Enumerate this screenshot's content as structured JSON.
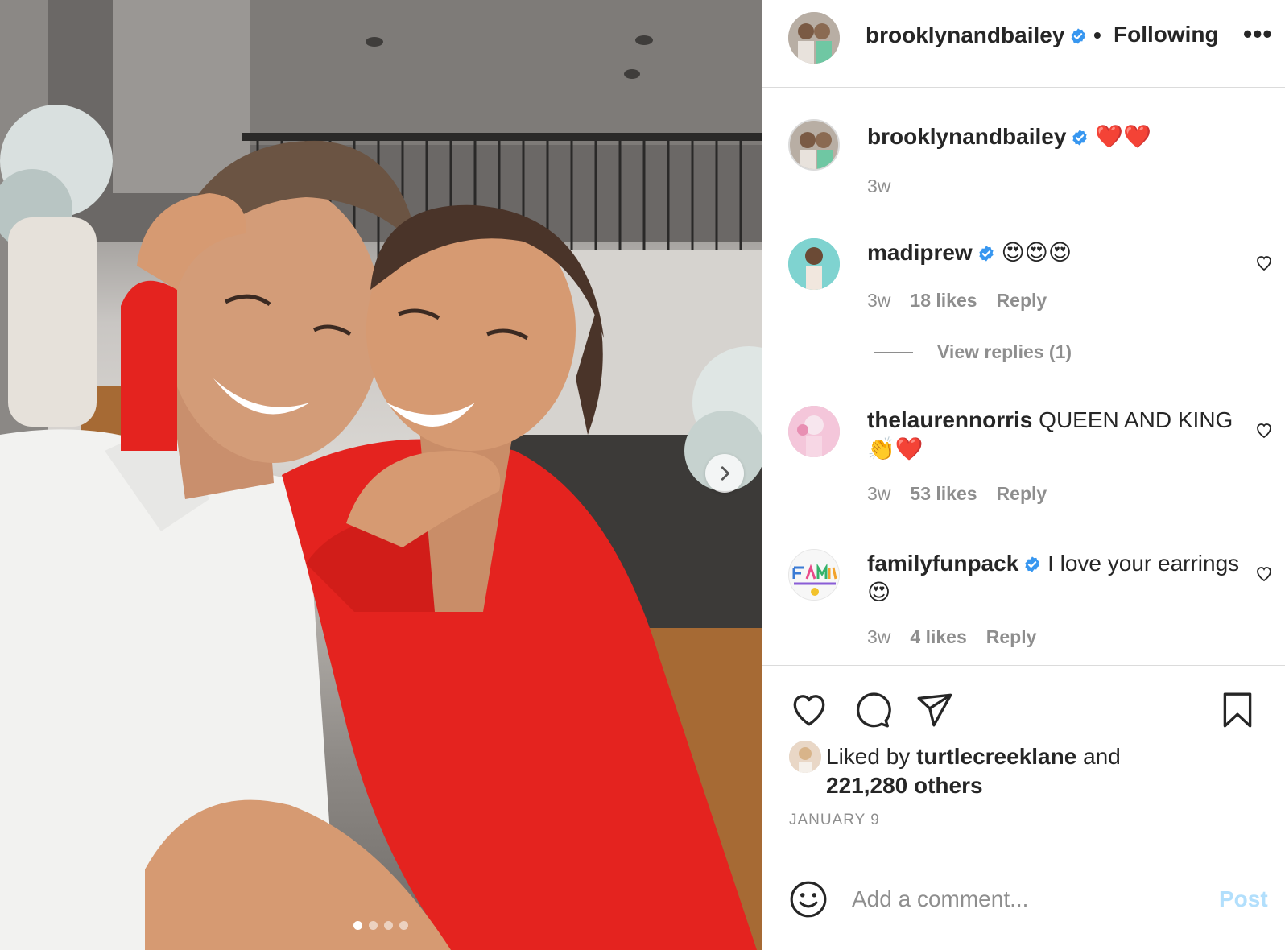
{
  "post": {
    "author": "brooklynandbailey",
    "follow_status": "Following",
    "more_label": "•••",
    "separator": "•",
    "caption_emoji": "❤️❤️",
    "caption_time": "3w"
  },
  "carousel": {
    "slide_count": 4,
    "active_index": 0
  },
  "comments": [
    {
      "user": "madiprew",
      "verified": true,
      "text": "😍😍😍",
      "time": "3w",
      "likes": "18 likes",
      "reply": "Reply",
      "view_replies": "View replies (1)"
    },
    {
      "user": "thelaurennorris",
      "verified": false,
      "text": "QUEEN AND KING 👏❤️",
      "time": "3w",
      "likes": "53 likes",
      "reply": "Reply"
    },
    {
      "user": "familyfunpack",
      "verified": true,
      "text": "I love your earrings 😍",
      "time": "3w",
      "likes": "4 likes",
      "reply": "Reply"
    }
  ],
  "likes": {
    "prefix": "Liked by",
    "user": "turtlecreeklane",
    "joiner": "and",
    "count": "221,280 others"
  },
  "date": "JANUARY 9",
  "add_comment": {
    "placeholder": "Add a comment...",
    "post_label": "Post"
  },
  "colors": {
    "verified": "#3897f0",
    "post_disabled": "#b2dffc",
    "muted": "#8e8e8e",
    "dress_red": "#e4231f"
  },
  "icons": {
    "like": "heart-icon",
    "comment": "comment-icon",
    "share": "paper-plane-icon",
    "save": "bookmark-icon",
    "emoji": "smiley-icon",
    "next": "chevron-right-icon"
  }
}
